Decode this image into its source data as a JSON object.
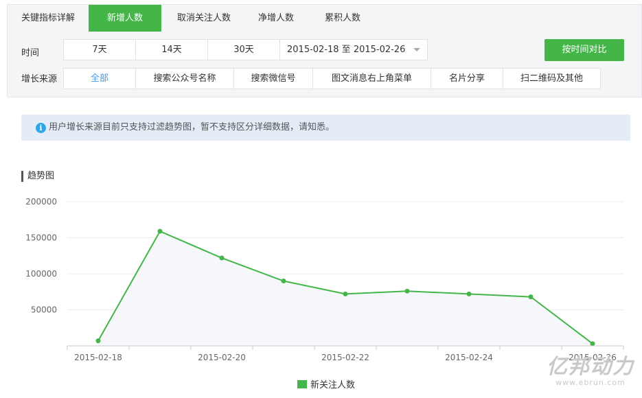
{
  "tabs": [
    {
      "label": "关键指标详解",
      "active": false
    },
    {
      "label": "新增人数",
      "active": true
    },
    {
      "label": "取消关注人数",
      "active": false
    },
    {
      "label": "净增人数",
      "active": false
    },
    {
      "label": "累积人数",
      "active": false
    }
  ],
  "filters": {
    "time_label": "时间",
    "time_options": [
      "7天",
      "14天",
      "30天"
    ],
    "date_range": "2015-02-18 至 2015-02-26",
    "compare_label": "按时间对比",
    "source_label": "增长来源",
    "source_options": [
      "全部",
      "搜索公众号名称",
      "搜索微信号",
      "图文消息右上角菜单",
      "名片分享",
      "扫二维码及其他"
    ],
    "source_selected": "全部"
  },
  "notice": {
    "icon": "info-icon",
    "text": "用户增长来源目前只支持过滤趋势图，暂不支持区分详细数据，请知悉。"
  },
  "section_title": "趋势图",
  "colors": {
    "accent": "#44b549",
    "link": "#459ae9",
    "notice_bg": "#e3ecf7",
    "info": "#2ea5e5"
  },
  "watermark": {
    "brand": "亿邦动力",
    "site": "www.ebrun.com"
  },
  "chart_data": {
    "type": "line",
    "x": [
      "2015-02-18",
      "2015-02-19",
      "2015-02-20",
      "2015-02-21",
      "2015-02-22",
      "2015-02-23",
      "2015-02-24",
      "2015-02-25",
      "2015-02-26"
    ],
    "x_tick_labels": [
      "2015-02-18",
      "2015-02-20",
      "2015-02-22",
      "2015-02-24",
      "2015-02-26"
    ],
    "series": [
      {
        "name": "新关注人数",
        "values": [
          7000,
          159000,
          122000,
          90000,
          72000,
          76000,
          72000,
          68000,
          3000
        ],
        "color": "#44b549"
      }
    ],
    "ylim": [
      0,
      200000
    ],
    "y_ticks": [
      50000,
      100000,
      150000,
      200000
    ],
    "grid": true,
    "legend": "bottom-center"
  }
}
